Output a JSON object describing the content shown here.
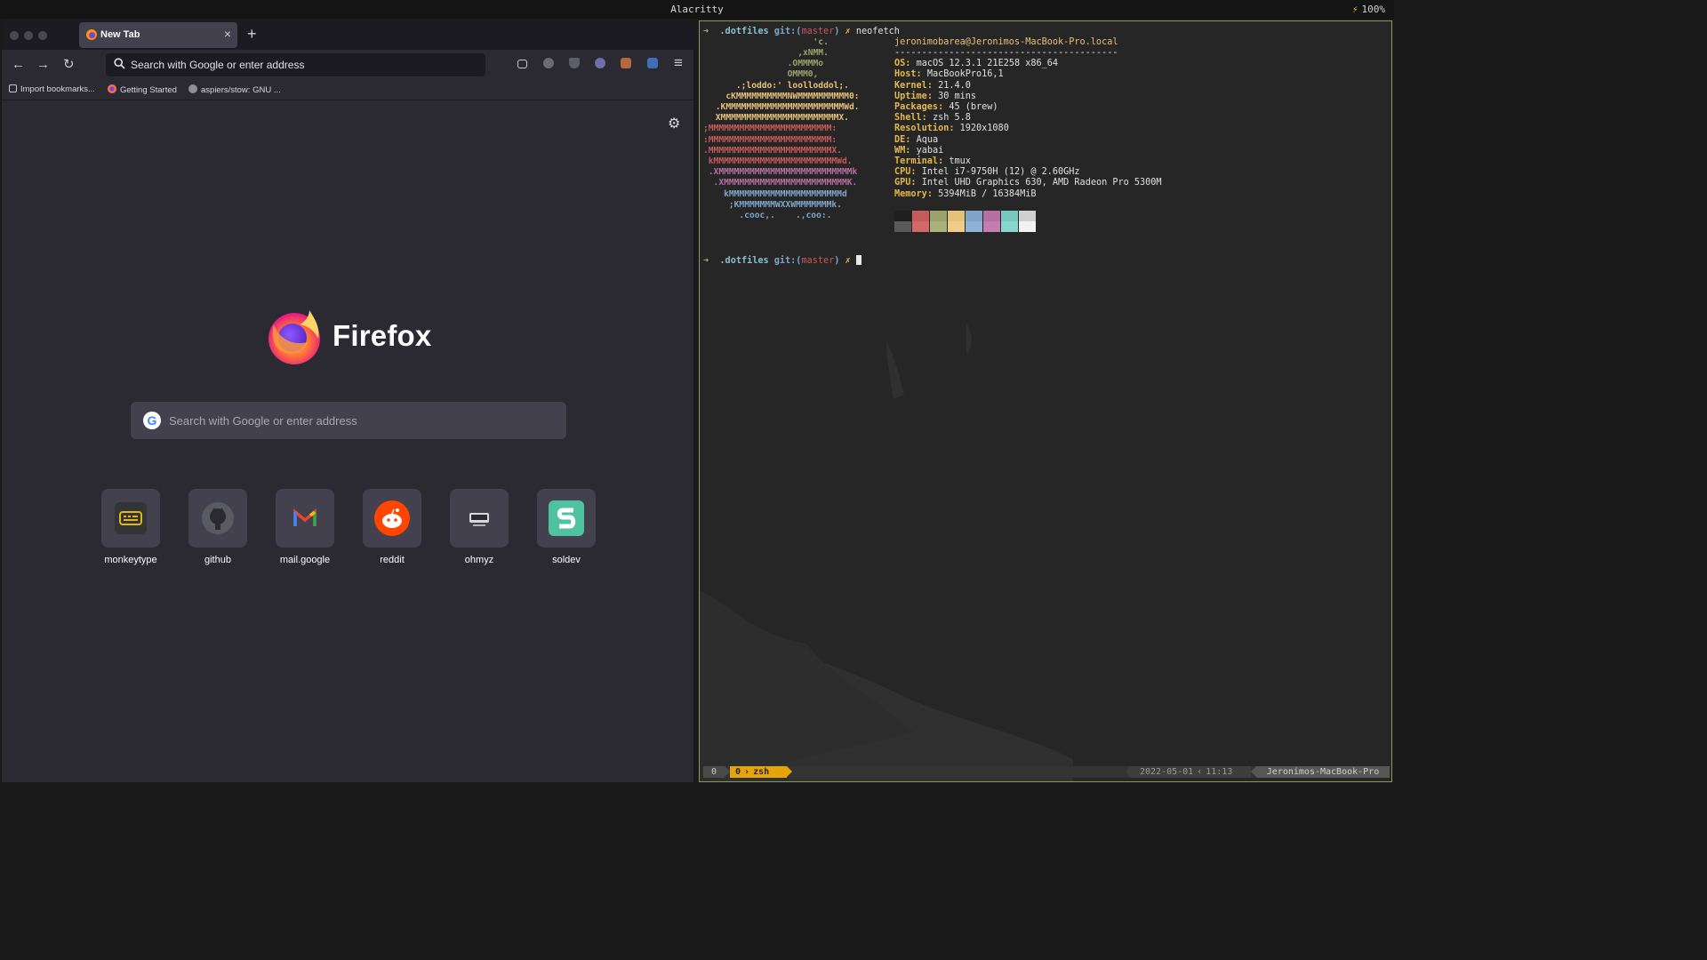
{
  "menubar": {
    "title": "Alacritty",
    "battery": "100%"
  },
  "firefox": {
    "tab": {
      "title": "New Tab",
      "close": "×"
    },
    "new_tab_plus": "+",
    "nav": {
      "back": "←",
      "forward": "→",
      "reload": "↻"
    },
    "urlbar": {
      "placeholder": "Search with Google or enter address"
    },
    "bookmarks": [
      "Import bookmarks...",
      "Getting Started",
      "aspiers/stow: GNU ..."
    ],
    "menu_icon": "≡",
    "newtab_page": {
      "brand": "Firefox",
      "search_placeholder": "Search with Google or enter address",
      "shortcuts": [
        {
          "label": "monkeytype",
          "icon": "keyboard-icon"
        },
        {
          "label": "github",
          "icon": "github-icon"
        },
        {
          "label": "mail.google",
          "icon": "gmail-icon"
        },
        {
          "label": "reddit",
          "icon": "reddit-icon"
        },
        {
          "label": "ohmyz",
          "icon": "terminal-icon"
        },
        {
          "label": "soldev",
          "icon": "s-icon"
        }
      ]
    }
  },
  "terminal": {
    "prompt1": {
      "dir": ".dotfiles",
      "git": "git:(",
      "branch": "master",
      "git_close": ")",
      "x": "✗",
      "cmd": "neofetch"
    },
    "neofetch": {
      "art": [
        "                    'c.",
        "                 ,xNMM.",
        "               .OMMMMo",
        "               OMMM0,",
        "     .;loddo:' loolloddol;.",
        "   cKMMMMMMMMMMNWMMMMMMMMMM0:",
        " .KMMMMMMMMMMMMMMMMMMMMMMMWd.",
        " XMMMMMMMMMMMMMMMMMMMMMMMX.",
        ";MMMMMMMMMMMMMMMMMMMMMMMM:",
        ":MMMMMMMMMMMMMMMMMMMMMMMM:",
        ".MMMMMMMMMMMMMMMMMMMMMMMMX.",
        " kMMMMMMMMMMMMMMMMMMMMMMMMWd.",
        " .XMMMMMMMMMMMMMMMMMMMMMMMMMMk",
        "  .XMMMMMMMMMMMMMMMMMMMMMMMMK.",
        "    kMMMMMMMMMMMMMMMMMMMMMMd",
        "     ;KMMMMMMMWXXWMMMMMMMk.",
        "       .cooc,.    .,coo:."
      ],
      "user_host": "jeronimobarea@Jeronimos-MacBook-Pro.local",
      "separator": "-----------------------------------------",
      "fields": [
        {
          "key": "OS",
          "value": "macOS 12.3.1 21E258 x86_64"
        },
        {
          "key": "Host",
          "value": "MacBookPro16,1"
        },
        {
          "key": "Kernel",
          "value": "21.4.0"
        },
        {
          "key": "Uptime",
          "value": "30 mins"
        },
        {
          "key": "Packages",
          "value": "45 (brew)"
        },
        {
          "key": "Shell",
          "value": "zsh 5.8"
        },
        {
          "key": "Resolution",
          "value": "1920x1080"
        },
        {
          "key": "DE",
          "value": "Aqua"
        },
        {
          "key": "WM",
          "value": "yabai"
        },
        {
          "key": "Terminal",
          "value": "tmux"
        },
        {
          "key": "CPU",
          "value": "Intel i7-9750H (12) @ 2.60GHz"
        },
        {
          "key": "GPU",
          "value": "Intel UHD Graphics 630, AMD Radeon Pro 5300M"
        },
        {
          "key": "Memory",
          "value": "5394MiB / 16384MiB"
        }
      ],
      "palette_top": [
        "#1e1e1e",
        "#c75a5a",
        "#9aa36b",
        "#e6c17a",
        "#7fa6c9",
        "#b76ea3",
        "#78c8c0",
        "#d0d0d0"
      ],
      "palette_bottom": [
        "#5a5a5a",
        "#d46767",
        "#a8b27a",
        "#f0cc88",
        "#8cb3d6",
        "#c57db1",
        "#88d6cd",
        "#f2f2f2"
      ]
    },
    "prompt2": {
      "dir": ".dotfiles",
      "git": "git:(",
      "branch": "master",
      "git_close": ")",
      "x": "✗"
    },
    "tmux": {
      "session": "0",
      "window_index": "0",
      "window_name": "zsh",
      "date": "2022-05-01",
      "time": "11:13",
      "host": "Jeronimos-MacBook-Pro"
    }
  }
}
